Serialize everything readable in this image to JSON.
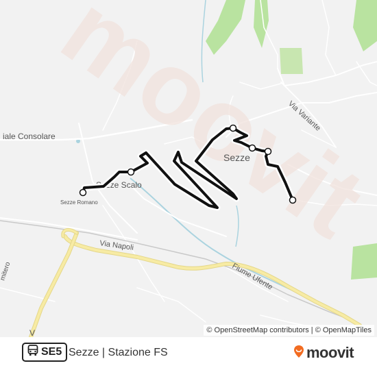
{
  "map": {
    "place_labels": {
      "consolare": "iale Consolare",
      "sezze_scalo": "Sezze Scalo",
      "sezze_romano": "Sezze Romano",
      "sezze": "Sezze",
      "via_napoli": "Via Napoli",
      "via_variante": "Via Variante",
      "fiume_ufente": "Fiume Ufente",
      "cimitero": "mitero",
      "bottom_partial": "V"
    },
    "watermark": "moovit",
    "attribution": "© OpenStreetMap contributors | © OpenMapTiles"
  },
  "route": {
    "code": "SE5",
    "title": "Sezze | Stazione FS",
    "icon": "bus-icon"
  },
  "brand": {
    "name": "moovit",
    "icon": "moovit-logo-icon",
    "color": "#f26c21"
  },
  "colors": {
    "water": "#aad3df",
    "green": "#b9e3a0",
    "major_road": "#f7eba4",
    "route_line": "#111111"
  }
}
